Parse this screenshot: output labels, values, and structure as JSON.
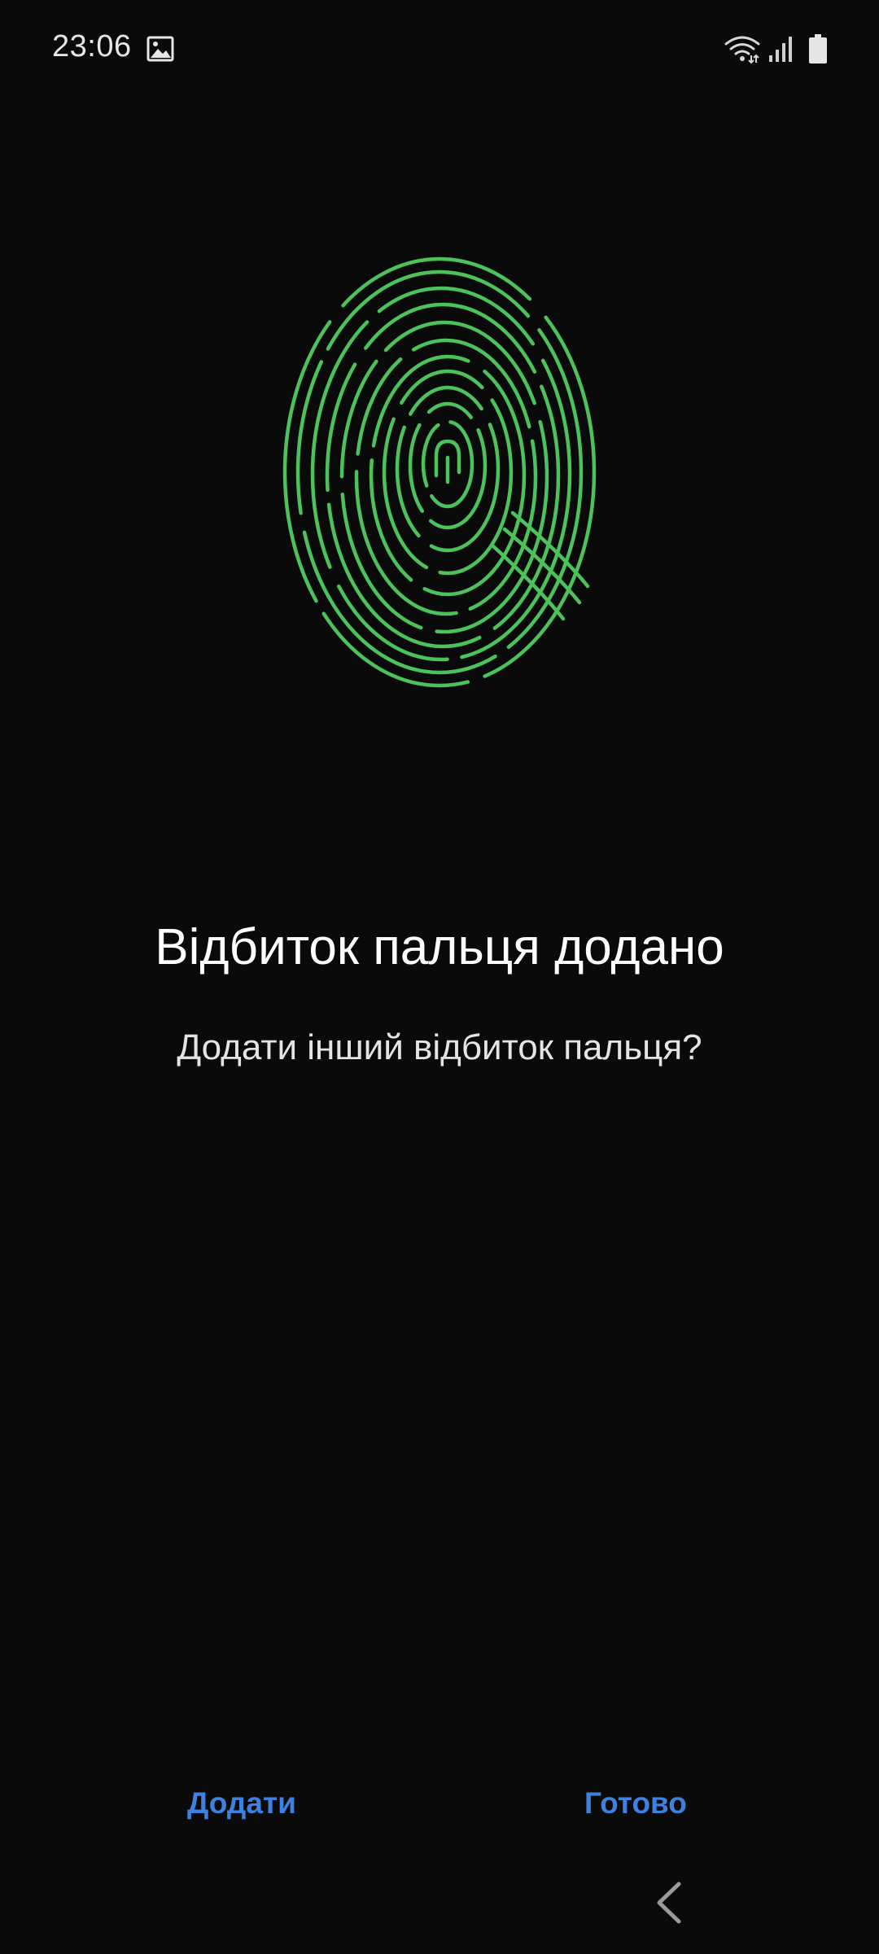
{
  "status_bar": {
    "time": "23:06",
    "icons": [
      "gallery-icon",
      "wifi-icon",
      "signal-icon",
      "battery-icon"
    ]
  },
  "illustration": {
    "icon": "fingerprint-icon",
    "color": "#4cc25a"
  },
  "content": {
    "title": "Відбиток пальця додано",
    "subtitle": "Додати інший відбиток пальця?"
  },
  "buttons": {
    "add_label": "Додати",
    "done_label": "Готово",
    "color": "#3d82e0"
  },
  "navigation": {
    "back_icon": "chevron-left-icon"
  }
}
